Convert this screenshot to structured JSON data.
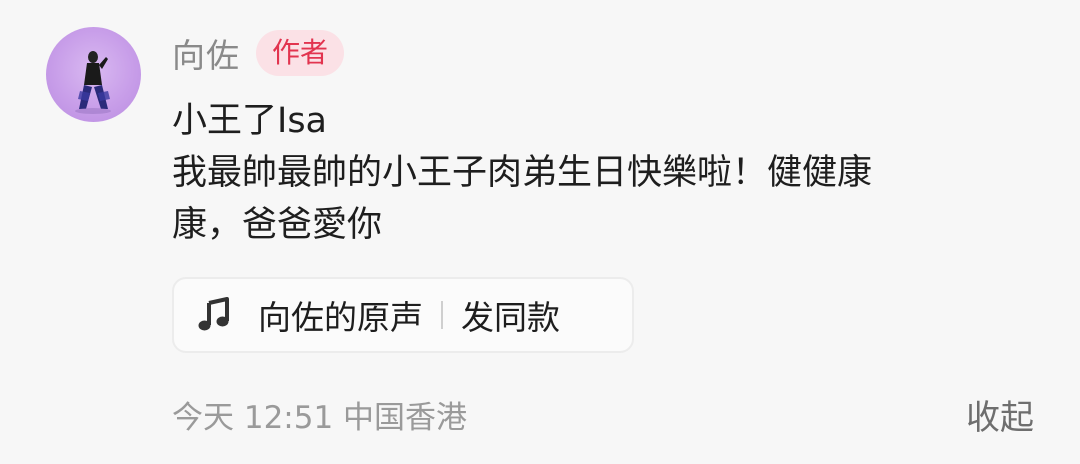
{
  "comment": {
    "author": "向佐",
    "badge": "作者",
    "lines": [
      "小王了Isa",
      "我最帥最帥的小王子肉弟生日快樂啦！健健康",
      "康，爸爸愛你"
    ],
    "music": {
      "icon": "music-note-icon",
      "title": "向佐的原声",
      "action": "发同款"
    },
    "meta": "今天 12:51 中国香港",
    "collapse_label": "收起"
  },
  "colors": {
    "background": "#f7f7f7",
    "badge_bg": "#fbe1e6",
    "badge_text": "#e2344f",
    "name_text": "#8a8a8a",
    "body_text": "#1e1e1e",
    "meta_text": "#9a9a9a"
  }
}
